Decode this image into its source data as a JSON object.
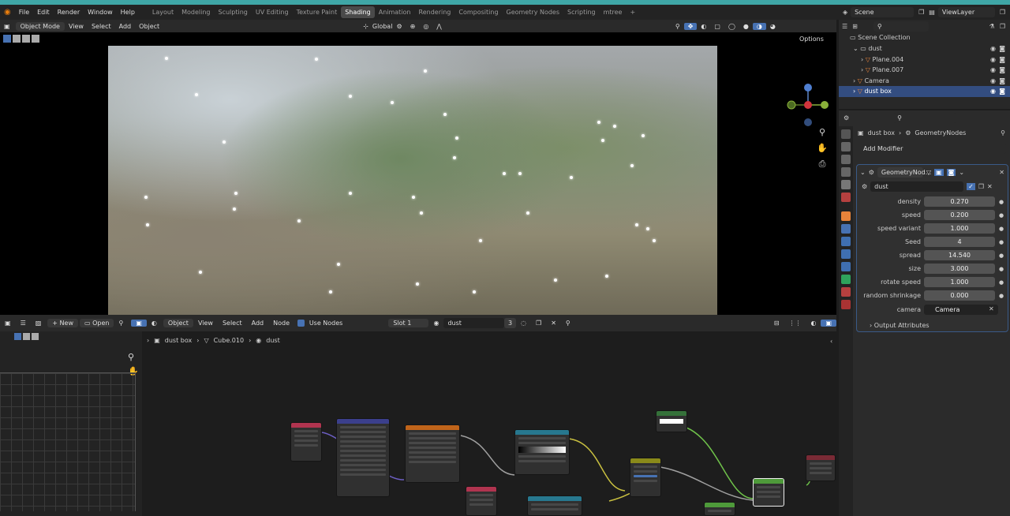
{
  "menubar": {
    "items": [
      "File",
      "Edit",
      "Render",
      "Window",
      "Help"
    ],
    "workspaces": [
      "Layout",
      "Modeling",
      "Sculpting",
      "UV Editing",
      "Texture Paint",
      "Shading",
      "Animation",
      "Rendering",
      "Compositing",
      "Geometry Nodes",
      "Scripting",
      "mtree"
    ],
    "active_workspace": "Shading",
    "add_tab": "+",
    "scene": "Scene",
    "view_layer": "ViewLayer"
  },
  "viewport_header": {
    "mode": "Object Mode",
    "menu": [
      "View",
      "Select",
      "Add",
      "Object"
    ],
    "orientation": "Global",
    "options": "Options"
  },
  "outliner": {
    "root": "Scene Collection",
    "items": [
      {
        "label": "dust",
        "depth": 1
      },
      {
        "label": "Plane.004",
        "depth": 2
      },
      {
        "label": "Plane.007",
        "depth": 2
      },
      {
        "label": "Camera",
        "depth": 1
      },
      {
        "label": "dust box",
        "depth": 1,
        "selected": true
      }
    ]
  },
  "properties": {
    "breadcrumb_object": "dust box",
    "breadcrumb_modifier": "GeometryNodes",
    "add_modifier": "Add Modifier",
    "modifier_name": "GeometryNod...",
    "node_group": "dust",
    "params": [
      {
        "label": "density",
        "value": "0.270"
      },
      {
        "label": "speed",
        "value": "0.200"
      },
      {
        "label": "speed variant",
        "value": "1.000"
      },
      {
        "label": "Seed",
        "value": "4"
      },
      {
        "label": "spread",
        "value": "14.540"
      },
      {
        "label": "size",
        "value": "3.000"
      },
      {
        "label": "rotate speed",
        "value": "1.000"
      },
      {
        "label": "random shrinkage",
        "value": "0.000"
      }
    ],
    "camera_label": "camera",
    "camera_value": "Camera",
    "output_attributes": "Output Attributes"
  },
  "node_header": {
    "new": "New",
    "open": "Open",
    "object_type": "Object",
    "menu": [
      "View",
      "Select",
      "Add",
      "Node"
    ],
    "use_nodes": "Use Nodes",
    "slot": "Slot 1",
    "material": "dust",
    "users": "3"
  },
  "node_breadcrumb": {
    "object": "dust box",
    "mesh": "Cube.010",
    "material": "dust"
  },
  "colors": {
    "accent": "#4772b3",
    "teal_strip": "#3fa6a6"
  }
}
